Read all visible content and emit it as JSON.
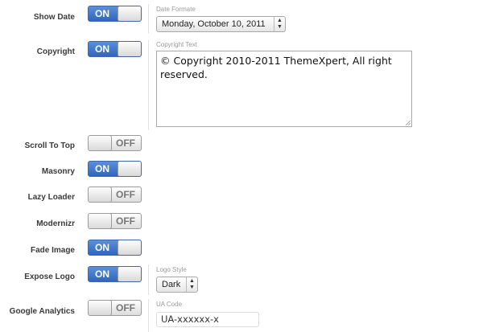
{
  "settings": [
    {
      "label": "Show Date",
      "state": "ON"
    },
    {
      "label": "Copyright",
      "state": "ON"
    },
    {
      "label": "Scroll To Top",
      "state": "OFF"
    },
    {
      "label": "Masonry",
      "state": "ON"
    },
    {
      "label": "Lazy Loader",
      "state": "OFF"
    },
    {
      "label": "Modernizr",
      "state": "OFF"
    },
    {
      "label": "Fade Image",
      "state": "ON"
    },
    {
      "label": "Expose Logo",
      "state": "ON"
    },
    {
      "label": "Google Analytics",
      "state": "OFF"
    }
  ],
  "date_format": {
    "label": "Date Formate",
    "value": "Monday, October 10, 2011"
  },
  "copyright_text": {
    "label": "Copyright Text",
    "value": "© Copyright 2010-2011 ThemeXpert, All right reserved."
  },
  "logo_style": {
    "label": "Logo Style",
    "value": "Dark"
  },
  "ua_code": {
    "label": "UA Code",
    "value": "UA-xxxxxx-x"
  },
  "icons": {
    "select_arrows": "up-down-chevron-icon",
    "resize_grip": "resize-grip-icon"
  },
  "colors": {
    "toggle_on": "#2f67be",
    "toggle_off": "#dcdcdc"
  }
}
